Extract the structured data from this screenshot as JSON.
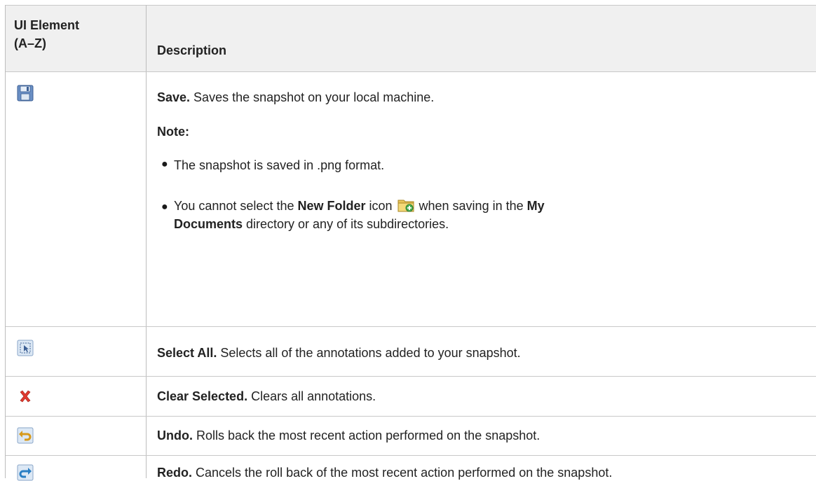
{
  "header": {
    "col1_line1": "UI Element",
    "col1_line2": "(A–Z)",
    "col2": "Description"
  },
  "rows": [
    {
      "icon": "save-disk-icon",
      "title": "Save.",
      "text": " Saves the snapshot on your local machine.",
      "note_label": "Note:",
      "bullets": [
        {
          "text": "The snapshot is saved in .png format."
        },
        {
          "part1": "You cannot select the ",
          "bold1": "New Folder",
          "part2": " icon ",
          "icon": "new-folder-icon",
          "part3": " when saving in the ",
          "bold2": "My",
          "bold3": "Documents",
          "part4": " directory or any of its subdirectories."
        }
      ]
    },
    {
      "icon": "select-all-icon",
      "title": "Select All.",
      "text": " Selects all of the annotations added to your snapshot."
    },
    {
      "icon": "red-x-icon",
      "title": "Clear Selected.",
      "text": " Clears all annotations."
    },
    {
      "icon": "undo-arrow-icon",
      "title": "Undo.",
      "text": " Rolls back the most recent action performed on the snapshot."
    },
    {
      "icon": "redo-arrow-icon",
      "title": "Redo.",
      "text": " Cancels the roll back of the most recent action performed on the snapshot."
    }
  ]
}
